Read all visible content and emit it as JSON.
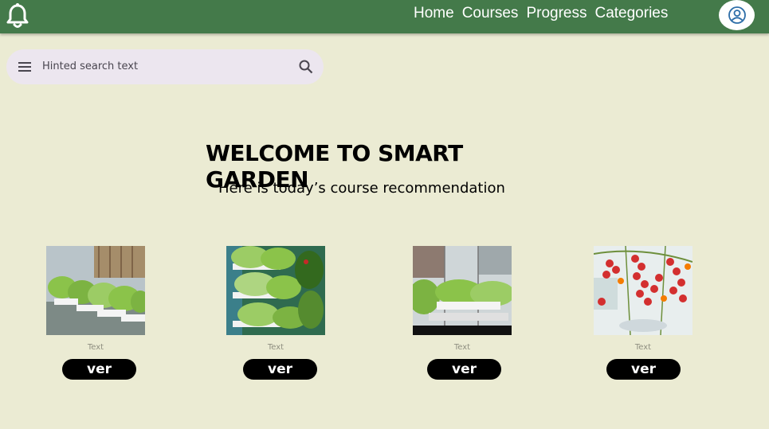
{
  "nav": {
    "items": [
      "Home",
      "Courses",
      "Progress",
      "Categories"
    ]
  },
  "search": {
    "placeholder": "Hinted search text"
  },
  "hero": {
    "title": "WELCOME TO SMART GARDEN",
    "subtitle": "Here is today’s course recommendation"
  },
  "cards": [
    {
      "caption": "Text",
      "button": "ver"
    },
    {
      "caption": "Text",
      "button": "ver"
    },
    {
      "caption": "Text",
      "button": "ver"
    },
    {
      "caption": "Text",
      "button": "ver"
    }
  ],
  "colors": {
    "topbar": "#447a4a",
    "background": "#ebebd3",
    "search_bg": "#ece6ef",
    "button": "#000000"
  }
}
